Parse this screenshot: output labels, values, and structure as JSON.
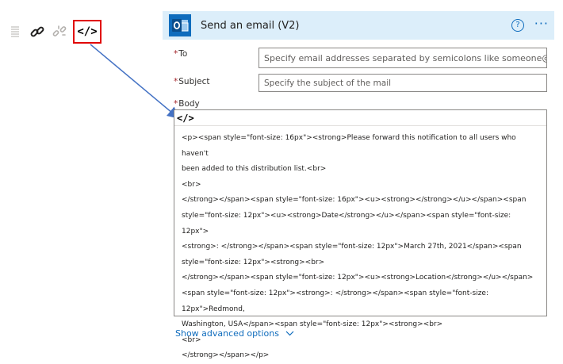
{
  "toolbar": {
    "icons": [
      "grip-icon",
      "link-icon",
      "unlink-icon",
      "code-view-icon"
    ],
    "code_label": "</>"
  },
  "card": {
    "title": "Send an email (V2)",
    "app_icon": "outlook-icon",
    "help_glyph": "?",
    "more_glyph": "···",
    "colors": {
      "header_bg": "#dceefa",
      "accent": "#0f6cbd",
      "required": "#a4262c"
    }
  },
  "fields": {
    "to": {
      "required_mark": "*",
      "label": "To",
      "placeholder": "Specify email addresses separated by semicolons like someone@con"
    },
    "subject": {
      "required_mark": "*",
      "label": "Subject",
      "placeholder": "Specify the subject of the mail"
    },
    "body": {
      "required_mark": "*",
      "label": "Body",
      "code_label": "</>",
      "lines": [
        "<p><span style=\"font-size: 16px\"><strong>Please forward this notification to all users who haven't",
        "been added to this distribution list.<br>",
        "<br>",
        "</strong></span><span style=\"font-size: 16px\"><u><strong></strong></u></span><span",
        "style=\"font-size: 12px\"><u><strong>Date</strong></u></span><span style=\"font-size: 12px\">",
        "<strong>: </strong></span><span style=\"font-size: 12px\">March 27th, 2021</span><span",
        "style=\"font-size: 12px\"><strong><br>",
        "</strong></span><span style=\"font-size: 12px\"><u><strong>Location</strong></u></span>",
        "<span style=\"font-size: 12px\"><strong>: </strong></span><span style=\"font-size: 12px\">Redmond,",
        "Washington, USA</span><span style=\"font-size: 12px\"><strong><br>",
        "<br>",
        "</strong></span></p>"
      ]
    }
  },
  "advanced": {
    "label": "Show advanced options",
    "icon": "chevron-down-icon"
  }
}
